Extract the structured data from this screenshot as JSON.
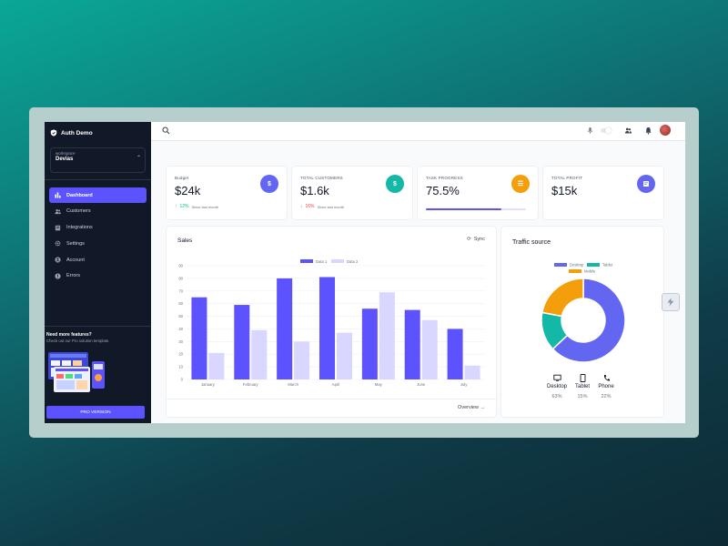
{
  "app": {
    "name": "Auth Demo"
  },
  "workspace": {
    "label": "workspace",
    "value": "Devias"
  },
  "sidebar": {
    "items": [
      {
        "label": "Dashboard",
        "icon": "bar-chart-icon",
        "active": true
      },
      {
        "label": "Customers",
        "icon": "users-icon"
      },
      {
        "label": "Integrations",
        "icon": "puzzle-icon"
      },
      {
        "label": "Settings",
        "icon": "gear-icon"
      },
      {
        "label": "Account",
        "icon": "user-circle-icon"
      },
      {
        "label": "Errors",
        "icon": "error-icon"
      }
    ],
    "promo_title": "Need more features?",
    "promo_text": "Check out our Pro solution template.",
    "pro_button": "PRO VERSION"
  },
  "kpis": [
    {
      "title": "Budget",
      "value": "$24k",
      "delta": "12%",
      "since": "Since last month",
      "icon": "$",
      "color": "#6366f1",
      "trend": "up"
    },
    {
      "title": "TOTAL CUSTOMERS",
      "value": "$1.6k",
      "delta": "16%",
      "since": "Since last month",
      "icon": "$",
      "color": "#14b8a6",
      "trend": "down"
    },
    {
      "title": "TASK PROGRESS",
      "value": "75.5%",
      "progress": 0.755,
      "icon": "list",
      "color": "#f59e0b"
    },
    {
      "title": "TOTAL PROFIT",
      "value": "$15k",
      "icon": "receipt",
      "color": "#6366f1"
    }
  ],
  "sales": {
    "title": "Sales",
    "sync": "Sync",
    "overview": "Overview"
  },
  "chart_data": {
    "type": "bar",
    "categories": [
      "January",
      "February",
      "March",
      "April",
      "May",
      "June",
      "July"
    ],
    "series": [
      {
        "name": "Data 1",
        "color": "#5c53ff",
        "values": [
          65,
          59,
          80,
          81,
          56,
          55,
          40
        ]
      },
      {
        "name": "Data 2",
        "color": "#d9d7ff",
        "values": [
          21,
          39,
          30,
          37,
          69,
          47,
          11
        ]
      }
    ],
    "yticks": [
      0,
      10,
      20,
      30,
      40,
      50,
      60,
      70,
      80,
      90
    ],
    "ylim": [
      0,
      90
    ],
    "legend": "top-center",
    "grid": true
  },
  "traffic": {
    "title": "Traffic source",
    "legend": [
      "Desktop",
      "Tablet",
      "Mobile"
    ],
    "chart": {
      "type": "pie",
      "labels": [
        "Desktop",
        "Tablet",
        "Mobile"
      ],
      "values": [
        63,
        15,
        22
      ],
      "colors": [
        "#6366f1",
        "#14b8a6",
        "#f59e0b"
      ]
    },
    "devices": [
      {
        "name": "Desktop",
        "pct": "63%",
        "icon": "monitor-icon"
      },
      {
        "name": "Tablet",
        "pct": "15%",
        "icon": "tablet-icon"
      },
      {
        "name": "Phone",
        "pct": "22%",
        "icon": "phone-icon"
      }
    ]
  },
  "colors": {
    "accent": "#5c53ff",
    "sidebar_bg": "#111827"
  }
}
